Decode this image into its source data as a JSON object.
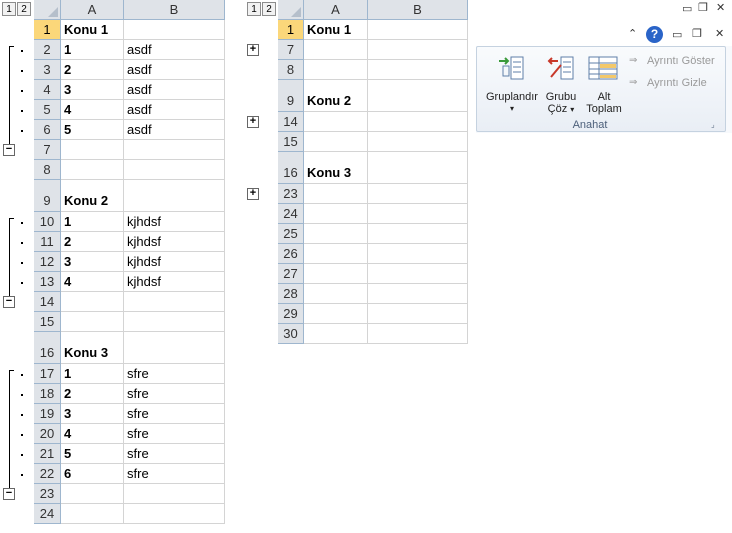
{
  "level_buttons": [
    "1",
    "2"
  ],
  "columns": [
    "A",
    "B"
  ],
  "sheet_left": {
    "rows": [
      {
        "num": "1",
        "a": "Konu 1",
        "b": "",
        "bold": true,
        "selected": true
      },
      {
        "num": "2",
        "a": "1",
        "b": "asdf",
        "bold": true
      },
      {
        "num": "3",
        "a": "2",
        "b": "asdf",
        "bold": true
      },
      {
        "num": "4",
        "a": "3",
        "b": "asdf",
        "bold": true
      },
      {
        "num": "5",
        "a": "4",
        "b": "asdf",
        "bold": true
      },
      {
        "num": "6",
        "a": "5",
        "b": "asdf",
        "bold": true
      },
      {
        "num": "7",
        "a": "",
        "b": ""
      },
      {
        "num": "8",
        "a": "",
        "b": ""
      },
      {
        "num": "9",
        "a": "Konu 2",
        "b": "",
        "bold": true,
        "gap": true
      },
      {
        "num": "10",
        "a": "1",
        "b": "kjhdsf",
        "bold": true
      },
      {
        "num": "11",
        "a": "2",
        "b": "kjhdsf",
        "bold": true
      },
      {
        "num": "12",
        "a": "3",
        "b": "kjhdsf",
        "bold": true
      },
      {
        "num": "13",
        "a": "4",
        "b": "kjhdsf",
        "bold": true
      },
      {
        "num": "14",
        "a": "",
        "b": ""
      },
      {
        "num": "15",
        "a": "",
        "b": ""
      },
      {
        "num": "16",
        "a": "Konu 3",
        "b": "",
        "bold": true,
        "gap": true
      },
      {
        "num": "17",
        "a": "1",
        "b": "sfre",
        "bold": true
      },
      {
        "num": "18",
        "a": "2",
        "b": "sfre",
        "bold": true
      },
      {
        "num": "19",
        "a": "3",
        "b": "sfre",
        "bold": true
      },
      {
        "num": "20",
        "a": "4",
        "b": "sfre",
        "bold": true
      },
      {
        "num": "21",
        "a": "5",
        "b": "sfre",
        "bold": true
      },
      {
        "num": "22",
        "a": "6",
        "b": "sfre",
        "bold": true
      },
      {
        "num": "23",
        "a": "",
        "b": ""
      },
      {
        "num": "24",
        "a": "",
        "b": ""
      }
    ]
  },
  "sheet_right": {
    "rows": [
      {
        "num": "1",
        "a": "Konu 1",
        "b": "",
        "bold": true,
        "selected": true
      },
      {
        "num": "7",
        "a": "",
        "b": ""
      },
      {
        "num": "8",
        "a": "",
        "b": ""
      },
      {
        "num": "9",
        "a": "Konu 2",
        "b": "",
        "bold": true,
        "gap": true
      },
      {
        "num": "14",
        "a": "",
        "b": ""
      },
      {
        "num": "15",
        "a": "",
        "b": ""
      },
      {
        "num": "16",
        "a": "Konu 3",
        "b": "",
        "bold": true,
        "gap": true
      },
      {
        "num": "23",
        "a": "",
        "b": ""
      },
      {
        "num": "24",
        "a": "",
        "b": ""
      },
      {
        "num": "25",
        "a": "",
        "b": ""
      },
      {
        "num": "26",
        "a": "",
        "b": ""
      },
      {
        "num": "27",
        "a": "",
        "b": ""
      },
      {
        "num": "28",
        "a": "",
        "b": ""
      },
      {
        "num": "29",
        "a": "",
        "b": ""
      },
      {
        "num": "30",
        "a": "",
        "b": ""
      }
    ]
  },
  "ribbon": {
    "group_label": "Anahat",
    "gruplandir": "Gruplandır",
    "grubu_coz_1": "Grubu",
    "grubu_coz_2": "Çöz",
    "alt_toplam_1": "Alt",
    "alt_toplam_2": "Toplam",
    "ayrinti_goster": "Ayrıntı Göster",
    "ayrinti_gizle": "Ayrıntı Gizle"
  },
  "colors": {
    "header_bg": "#dfe3e8",
    "selected_row": "#fbd77a",
    "help_blue": "#2a64c8"
  }
}
